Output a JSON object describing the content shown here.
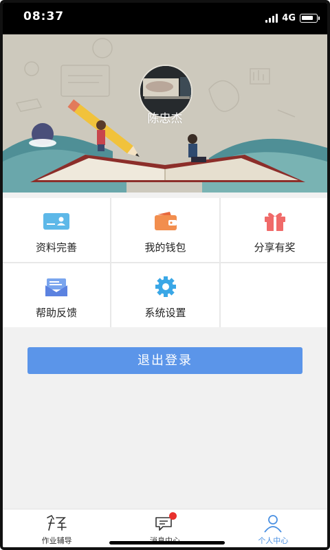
{
  "status_bar": {
    "time": "08:37",
    "network": "4G"
  },
  "profile": {
    "name": "陈忠杰"
  },
  "menu": [
    {
      "label": "资料完善",
      "icon": "id-card-icon"
    },
    {
      "label": "我的钱包",
      "icon": "wallet-icon"
    },
    {
      "label": "分享有奖",
      "icon": "gift-icon"
    },
    {
      "label": "帮助反馈",
      "icon": "feedback-envelope-icon"
    },
    {
      "label": "系统设置",
      "icon": "gear-icon"
    }
  ],
  "logout": {
    "label": "退出登录"
  },
  "tabbar": [
    {
      "label": "作业辅导",
      "icon": "homework-icon",
      "active": false
    },
    {
      "label": "消息中心",
      "icon": "message-icon",
      "active": false,
      "badge": true
    },
    {
      "label": "个人中心",
      "icon": "person-icon",
      "active": true
    }
  ],
  "colors": {
    "accent": "#4a90e2",
    "button": "#5b95e9",
    "badge": "#e8312e"
  }
}
